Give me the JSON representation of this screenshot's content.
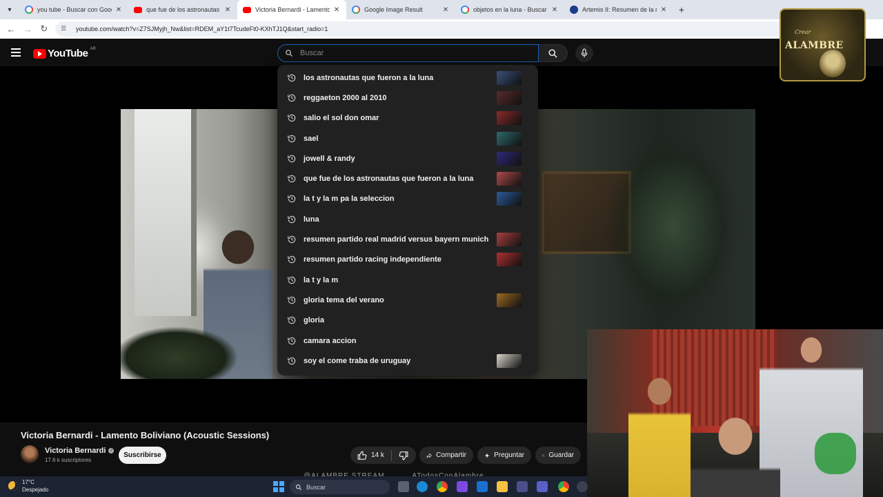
{
  "tabs": [
    {
      "title": "you tube - Buscar con Google",
      "favicon": "google-icon",
      "active": false
    },
    {
      "title": "que fue de los astronautas que",
      "favicon": "youtube-icon",
      "active": false
    },
    {
      "title": "Victoria Bernardi - Lamento Bo",
      "favicon": "youtube-icon",
      "active": true
    },
    {
      "title": "Google Image Result",
      "favicon": "google-icon",
      "active": false
    },
    {
      "title": "objetos en la luna - Buscar con",
      "favicon": "google-icon",
      "active": false
    },
    {
      "title": "Artemis II: Resumen de la misió",
      "favicon": "nasa-icon",
      "active": false
    }
  ],
  "address_bar": {
    "url": "youtube.com/watch?v=Z7SJMyjh_Nw&list=RDEM_aY1t7TcudeFt0-KXhTJ1Q&start_radio=1"
  },
  "masthead": {
    "logo_text": "YouTube",
    "region": "AR",
    "search_placeholder": "Buscar"
  },
  "suggestions": [
    {
      "text": "los astronautas que fueron a la luna",
      "thumb": "#3a4f7a"
    },
    {
      "text": "reggaeton 2000 al 2010",
      "thumb": "#5a2a2a"
    },
    {
      "text": "salio el sol don omar",
      "thumb": "#8a2a2a"
    },
    {
      "text": "sael",
      "thumb": "#2f6a6e"
    },
    {
      "text": "jowell & randy",
      "thumb": "#2f2a7a"
    },
    {
      "text": "que fue de los astronautas que fueron a la luna",
      "thumb": "#b04a4a"
    },
    {
      "text": "la t y la m pa la seleccion",
      "thumb": "#2a5a9a"
    },
    {
      "text": "luna",
      "thumb": null
    },
    {
      "text": "resumen partido real madrid versus bayern munich",
      "thumb": "#a84040"
    },
    {
      "text": "resumen partido racing independiente",
      "thumb": "#b03030"
    },
    {
      "text": "la t y la m",
      "thumb": null
    },
    {
      "text": "gloria tema del verano",
      "thumb": "#9a6a20"
    },
    {
      "text": "gloria",
      "thumb": null
    },
    {
      "text": "camara accion",
      "thumb": null
    },
    {
      "text": "soy el come traba de uruguay",
      "thumb": "#d8d4c8"
    }
  ],
  "video": {
    "title": "Victoria Bernardi - Lamento Boliviano (Acoustic Sessions)",
    "channel": "Victoria Bernardi",
    "subscribers": "17.6 k suscriptores",
    "subscribe_label": "Suscribirse",
    "likes": "14 k",
    "share_label": "Compartir",
    "ask_label": "Preguntar",
    "save_label": "Guardar"
  },
  "overlay": {
    "brand_text": "ALAMBRE",
    "brand_sub": "Crear",
    "tags": [
      "@ALAMBRE.STREAM",
      "ATodosConAlambre"
    ]
  },
  "taskbar": {
    "temperature": "17°C",
    "condition": "Despejado",
    "search_placeholder": "Buscar"
  }
}
